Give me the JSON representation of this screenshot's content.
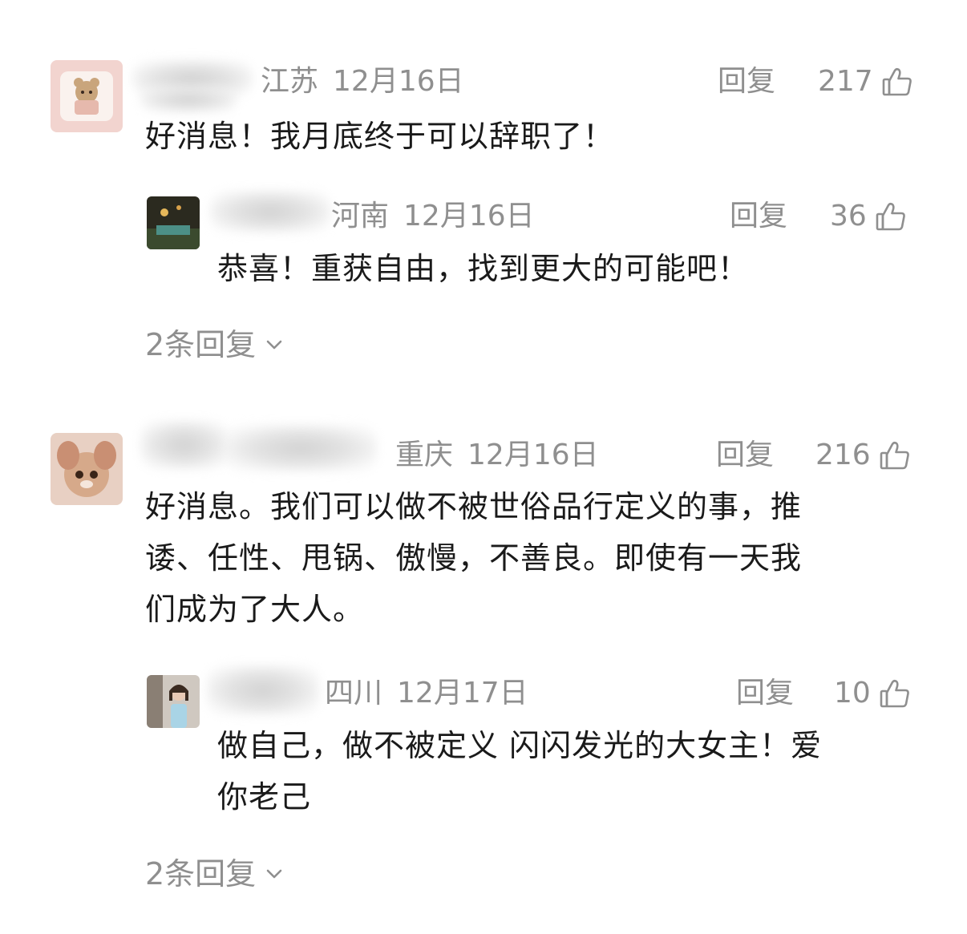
{
  "comments": [
    {
      "location": "江苏",
      "date": "12月16日",
      "reply_label": "回复",
      "likes": "217",
      "text": "好消息！我月底终于可以辞职了！",
      "reply": {
        "location": "河南",
        "date": "12月16日",
        "reply_label": "回复",
        "likes": "36",
        "text": "恭喜！重获自由，找到更大的可能吧！"
      },
      "more_replies": "2条回复"
    },
    {
      "location": "重庆",
      "date": "12月16日",
      "reply_label": "回复",
      "likes": "216",
      "text_lines": [
        "好消息。我们可以做不被世俗品行定义的事，推",
        "诿、任性、甩锅、傲慢，不善良。即使有一天我",
        "们成为了大人。"
      ],
      "reply": {
        "location": "四川",
        "date": "12月17日",
        "reply_label": "回复",
        "likes": "10",
        "text_lines": [
          "做自己，做不被定义 闪闪发光的大女主！爱",
          "你老己"
        ]
      },
      "more_replies": "2条回复"
    }
  ],
  "icons": {
    "like": "thumbs-up-icon",
    "expand": "chevron-down-icon"
  },
  "colors": {
    "meta": "#8f8f8f",
    "text": "#1a1a1a"
  }
}
